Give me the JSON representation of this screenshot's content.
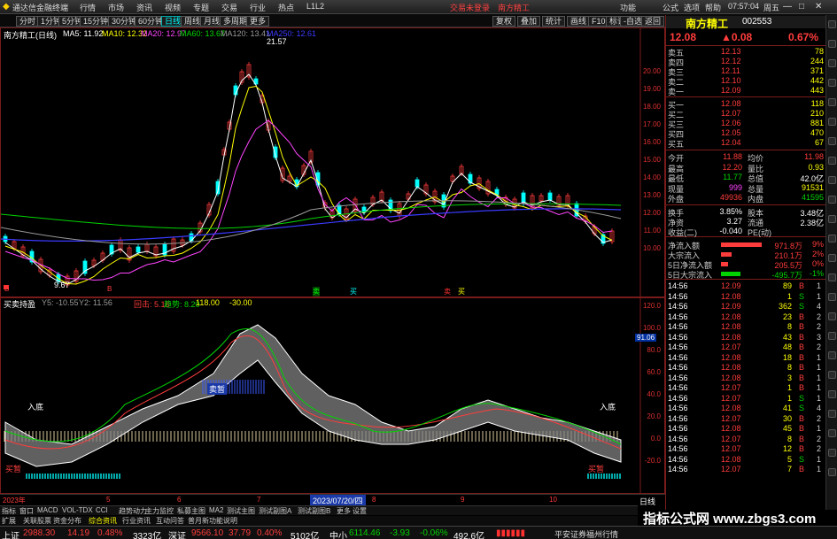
{
  "titlebar": {
    "app_name": "通达信金融终端",
    "menus": [
      "行情",
      "市场",
      "资讯",
      "视频",
      "专题",
      "交易",
      "行业",
      "热点",
      "L1L2"
    ],
    "trade_status": "交易未登录",
    "stock_title": "南方精工",
    "right_menus": [
      "功能",
      "能",
      "公式",
      "选项",
      "帮助"
    ],
    "time": "07:57:04",
    "weekday": "周五"
  },
  "periods": [
    "分时",
    "1分钟",
    "5分钟",
    "15分钟",
    "30分钟",
    "60分钟",
    "日线",
    "周线",
    "月线",
    "多周期",
    "更多"
  ],
  "right_toolbar": [
    "复权",
    "叠加",
    "统计",
    "画线",
    "F10",
    "标记",
    "-自选",
    "返回"
  ],
  "main_header": {
    "name": "南方精工(日线)",
    "ma": [
      {
        "label": "MA5: 11.92",
        "color": "#ffffff"
      },
      {
        "label": "MA10: 12.32",
        "color": "#ffff00"
      },
      {
        "label": "MA20: 12.97",
        "color": "#ff44ff"
      },
      {
        "label": "MA60: 13.67",
        "color": "#00d400"
      },
      {
        "label": "MA120: 13.41",
        "color": "#9a9a9a"
      },
      {
        "label": "MA250: 12.61",
        "color": "#3a3aff"
      }
    ]
  },
  "price_axis": [
    "20.00",
    "19.00",
    "18.00",
    "17.00",
    "16.00",
    "15.00",
    "14.00",
    "13.00",
    "12.00",
    "11.00",
    "10.00"
  ],
  "annotations": {
    "high": "21.57",
    "low": "9.67",
    "b_marks": [
      "B",
      "B"
    ],
    "s_marks": [
      "卖",
      "买",
      "卖",
      "买"
    ]
  },
  "sub_header": {
    "name": "买卖持盈",
    "y1": "Y5: -10.55",
    "y2": "Y2: 11.56",
    "items": [
      {
        "label": "回击: 5.16",
        "color": "#ff3c3c"
      },
      {
        "label": "趋势: 8.20",
        "color": "#00d400"
      },
      {
        "label": "118.00",
        "color": "#ffff00"
      },
      {
        "label": "-30.00",
        "color": "#ffff00"
      }
    ]
  },
  "sub_axis": [
    "120.0",
    "100.0",
    "80.0",
    "60.0",
    "40.0",
    "20.0",
    "0.0",
    "-20.0"
  ],
  "sub_badge": "91.06",
  "sub_labels": {
    "entry_left": "入底",
    "entry_right": "入底",
    "sell": "卖暂",
    "buy_left": "买暂",
    "buy_right": "买暂"
  },
  "date_axis": {
    "left": "2023年",
    "marks": [
      "5",
      "6",
      "7",
      "8",
      "9",
      "10"
    ],
    "cursor": "2023/07/20/四",
    "right": "日线"
  },
  "bottom_tabs": [
    "指标",
    "窗口",
    "MACD",
    "VOL-TDX",
    "CCI",
    "趋势动力",
    "主力监控",
    "私募主图",
    "MA2",
    "测试主图",
    "测试副图A",
    "测试副图B",
    "更多",
    "设置"
  ],
  "bottom_tabs2": [
    "扩展",
    "关联股票",
    "资金分布",
    "综合资讯",
    "行业资讯",
    "互动问答",
    "普月新功能说明"
  ],
  "quote": {
    "name": "南方精工",
    "code": "002553",
    "price": "12.08",
    "change": "▲0.08",
    "pct": "0.67%",
    "asks": [
      {
        "label": "卖五",
        "price": "12.13",
        "vol": "78"
      },
      {
        "label": "卖四",
        "price": "12.12",
        "vol": "244"
      },
      {
        "label": "卖三",
        "price": "12.11",
        "vol": "371"
      },
      {
        "label": "卖二",
        "price": "12.10",
        "vol": "442"
      },
      {
        "label": "卖一",
        "price": "12.09",
        "vol": "443"
      }
    ],
    "bids": [
      {
        "label": "买一",
        "price": "12.08",
        "vol": "118"
      },
      {
        "label": "买二",
        "price": "12.07",
        "vol": "210"
      },
      {
        "label": "买三",
        "price": "12.06",
        "vol": "881"
      },
      {
        "label": "买四",
        "price": "12.05",
        "vol": "470"
      },
      {
        "label": "买五",
        "price": "12.04",
        "vol": "67"
      }
    ],
    "stats": [
      [
        "今开",
        "11.88",
        "均价",
        "11.98"
      ],
      [
        "最高",
        "12.20",
        "量比",
        "0.93"
      ],
      [
        "最低",
        "11.77",
        "总值",
        "42.0亿"
      ],
      [
        "现量",
        "999",
        "总量",
        "91531"
      ],
      [
        "外盘",
        "49936",
        "内盘",
        "41595"
      ]
    ],
    "stats2": [
      [
        "换手",
        "3.85%",
        "股本",
        "3.48亿"
      ],
      [
        "净资",
        "3.27",
        "流通",
        "2.38亿"
      ],
      [
        "收益(二)",
        "-0.040",
        "PE(动)",
        ""
      ]
    ],
    "flows": [
      {
        "label": "净流入额",
        "val": "971.8万",
        "pct": "9%"
      },
      {
        "label": "大宗流入",
        "val": "210.1万",
        "pct": "2%"
      },
      {
        "label": "5日净流入额",
        "val": "205.5万",
        "pct": "0%"
      },
      {
        "label": "5日大宗流入",
        "val": "-495.7万",
        "pct": "-1%"
      }
    ],
    "ticks": [
      [
        "14:56",
        "12.09",
        "89",
        "B",
        "1"
      ],
      [
        "14:56",
        "12.08",
        "1",
        "S",
        "1"
      ],
      [
        "14:56",
        "12.09",
        "362",
        "S",
        "4"
      ],
      [
        "14:56",
        "12.08",
        "23",
        "B",
        "2"
      ],
      [
        "14:56",
        "12.08",
        "8",
        "B",
        "2"
      ],
      [
        "14:56",
        "12.08",
        "43",
        "B",
        "3"
      ],
      [
        "14:56",
        "12.07",
        "48",
        "B",
        "2"
      ],
      [
        "14:56",
        "12.08",
        "18",
        "B",
        "1"
      ],
      [
        "14:56",
        "12.08",
        "8",
        "B",
        "1"
      ],
      [
        "14:56",
        "12.08",
        "3",
        "B",
        "1"
      ],
      [
        "14:56",
        "12.07",
        "1",
        "B",
        "1"
      ],
      [
        "14:56",
        "12.07",
        "1",
        "S",
        "1"
      ],
      [
        "14:56",
        "12.08",
        "41",
        "S",
        "4"
      ],
      [
        "14:56",
        "12.07",
        "30",
        "B",
        "2"
      ],
      [
        "14:56",
        "12.08",
        "45",
        "B",
        "1"
      ],
      [
        "14:56",
        "12.07",
        "8",
        "B",
        "2"
      ],
      [
        "14:56",
        "12.07",
        "12",
        "B",
        "2"
      ],
      [
        "14:56",
        "12.08",
        "5",
        "S",
        "1"
      ],
      [
        "14:56",
        "12.07",
        "7",
        "B",
        "1"
      ]
    ]
  },
  "statusbar": {
    "sh_label": "上证",
    "sh_val": "2988.30",
    "sh_chg": "14.19",
    "sh_pct": "0.48%",
    "sh_amt": "3323亿",
    "sz_label": "深证",
    "sz_val": "9566.10",
    "sz_chg": "37.79",
    "sz_pct": "0.40%",
    "sz_amt": "5102亿",
    "zx_label": "中小",
    "zx_val": "6114.46",
    "zx_chg": "-3.93",
    "zx_pct": "-0.06%",
    "zx_amt": "492.6亿",
    "broker": "平安证券福州行情"
  },
  "watermark": "指标公式网 www.zbgs3.com"
}
